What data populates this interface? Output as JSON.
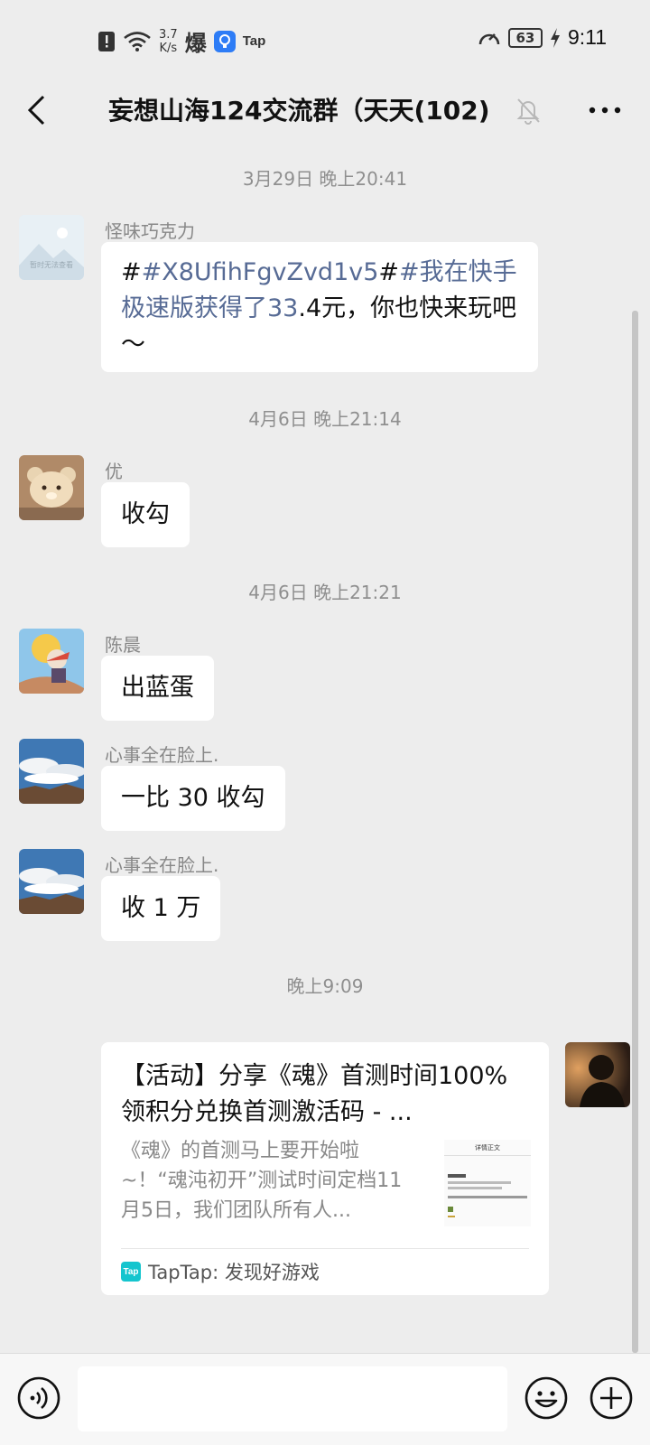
{
  "status_bar": {
    "net_speed_value": "3.7",
    "net_speed_unit": "K/s",
    "bomb_char": "爆",
    "tap_label": "Tap",
    "battery": "63",
    "time": "9:11"
  },
  "header": {
    "title": "妄想山海124交流群（天天(102)"
  },
  "messages": [
    {
      "type": "timestamp",
      "text": "3月29日 晚上20:41"
    },
    {
      "type": "message",
      "sender": "怪味巧克力",
      "avatar_caption": "暂时无法查看",
      "segments": [
        {
          "text": "#",
          "link": false
        },
        {
          "text": "#X8UfihFgvZvd1v5",
          "link": true
        },
        {
          "text": "#",
          "link": false
        },
        {
          "text": "#我在快手极速版获得了33",
          "link": true
        },
        {
          "text": ".4元，你也快来玩吧～",
          "link": false
        }
      ]
    },
    {
      "type": "timestamp",
      "text": "4月6日 晚上21:14"
    },
    {
      "type": "message",
      "sender": "优",
      "text": "收勾"
    },
    {
      "type": "timestamp",
      "text": "4月6日 晚上21:21"
    },
    {
      "type": "message",
      "sender": "陈晨",
      "text": "出蓝蛋"
    },
    {
      "type": "message",
      "sender": "心事全在脸上.",
      "text": "一比 30 收勾"
    },
    {
      "type": "message",
      "sender": "心事全在脸上.",
      "text": "收 1 万"
    },
    {
      "type": "timestamp",
      "text": "晚上9:09"
    }
  ],
  "link_card": {
    "title": "【活动】分享《魂》首测时间100%领积分兑换首测激活码 - ...",
    "description": "《魂》的首测马上要开始啦~！“魂沌初开”测试时间定档11月5日，我们团队所有人...",
    "thumb_title": "详情正文",
    "source": "TapTap: 发现好游戏",
    "source_logo": "Tap"
  },
  "colors": {
    "background": "#ededed",
    "bubble": "#ffffff",
    "link": "#576b95",
    "timestamp": "#8f8f8f",
    "taptap": "#15c5ce"
  }
}
